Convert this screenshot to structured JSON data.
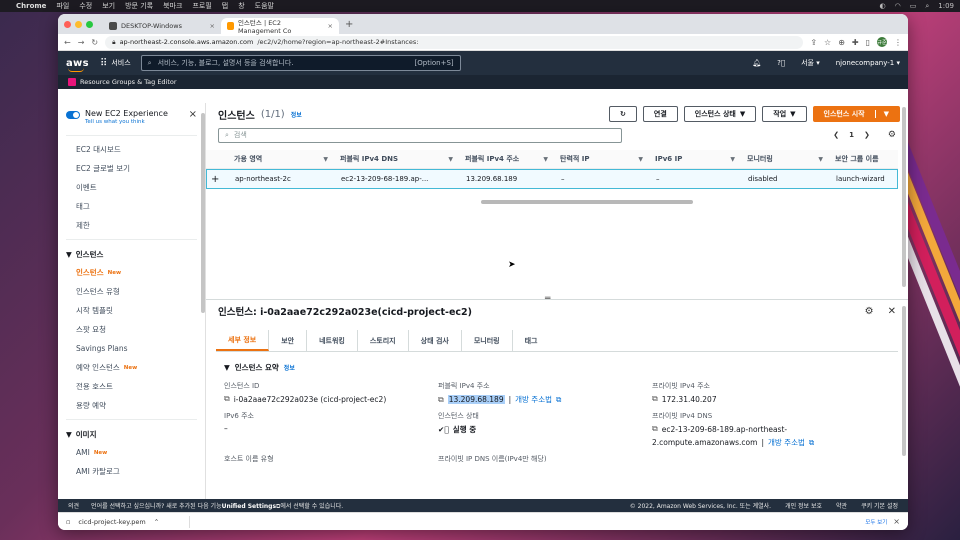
{
  "menubar": {
    "app": "Chrome",
    "items": [
      "파일",
      "수정",
      "보기",
      "방문 기록",
      "북마크",
      "프로필",
      "탭",
      "창",
      "도움말"
    ],
    "time": "1:09"
  },
  "browser": {
    "tabs": [
      {
        "title": "DESKTOP-Windows",
        "color": "#4a4a4a"
      },
      {
        "title": "인스턴스 | EC2 Management Co",
        "color": "#ff9900"
      }
    ],
    "url_host": "ap-northeast-2.console.aws.amazon.com",
    "url_path": "/ec2/v2/home?region=ap-northeast-2#Instances:",
    "profile_initials": "규준"
  },
  "aws": {
    "logo": "aws",
    "services_label": "서비스",
    "search_placeholder": "서비스, 기능, 블로그, 설명서 등을 검색합니다.",
    "search_shortcut": "[Option+S]",
    "region": "서울",
    "account": "njonecompany-1",
    "resource_groups": "Resource Groups & Tag Editor"
  },
  "sidebar": {
    "new_experience_title": "New EC2 Experience",
    "new_experience_link": "Tell us what you think",
    "top_items": [
      "EC2 대시보드",
      "EC2 글로벌 보기",
      "이벤트",
      "태그",
      "제한"
    ],
    "section_instances": "인스턴스",
    "instances_items": [
      {
        "label": "인스턴스",
        "new": "New",
        "active": true
      },
      {
        "label": "인스턴스 유형"
      },
      {
        "label": "시작 템플릿"
      },
      {
        "label": "스팟 요청"
      },
      {
        "label": "Savings Plans"
      },
      {
        "label": "예약 인스턴스",
        "new": "New"
      },
      {
        "label": "전용 호스트"
      },
      {
        "label": "용량 예약"
      }
    ],
    "section_images": "이미지",
    "images_items": [
      {
        "label": "AMI",
        "new": "New"
      },
      {
        "label": "AMI 카탈로그"
      }
    ]
  },
  "instances": {
    "title": "인스턴스",
    "count": "(1/1)",
    "info": "정보",
    "btn_connect": "연결",
    "btn_state": "인스턴스 상태",
    "btn_actions": "작업",
    "btn_launch": "인스턴스 시작",
    "filter_placeholder": "검색",
    "page": "1",
    "columns": [
      "가용 영역",
      "퍼블릭 IPv4 DNS",
      "퍼블릭 IPv4 주소",
      "탄력적 IP",
      "IPv6 IP",
      "모니터링",
      "보안 그룹 이름"
    ],
    "row": [
      "ap-northeast-2c",
      "ec2-13-209-68-189.ap-...",
      "13.209.68.189",
      "–",
      "–",
      "disabled",
      "launch-wizard"
    ]
  },
  "details": {
    "header": "인스턴스: i-0a2aae72c292a023e(cicd-project-ec2)",
    "tabs": [
      "세부 정보",
      "보안",
      "네트워킹",
      "스토리지",
      "상태 검사",
      "모니터링",
      "태그"
    ],
    "summary_title": "인스턴스 요약",
    "summary_info": "정보",
    "instance_id_label": "인스턴스 ID",
    "instance_id_value": "i-0a2aae72c292a023e (cicd-project-ec2)",
    "public_ip_label": "퍼블릭 IPv4 주소",
    "public_ip_value": "13.209.68.189",
    "open_address": "개방 주소법",
    "private_ip_label": "프라이빗 IPv4 주소",
    "private_ip_value": "172.31.40.207",
    "ipv6_label": "IPv6 주소",
    "ipv6_value": "–",
    "state_label": "인스턴스 상태",
    "state_value": "실행 중",
    "private_dns_label": "프라이빗 IPv4 DNS",
    "private_dns_value1": "ec2-13-209-68-189.ap-northeast-",
    "private_dns_value2": "2.compute.amazonaws.com",
    "hostname_type_label": "호스트 이름 유형",
    "private_ip_dns_label": "프라이빗 IP DNS 이름(IPv4만 해당)"
  },
  "footer": {
    "feedback": "의견",
    "lang_text_pre": "언어를 선택하고 싶으십니까? 새로 추가된 다음 기능",
    "unified": "Unified Settings",
    "lang_text_post": "에서 선택할 수 있습니다.",
    "copyright": "© 2022, Amazon Web Services, Inc. 또는 계열사.",
    "privacy": "개인 정보 보호",
    "terms": "약관",
    "cookies": "쿠키 기본 설정"
  },
  "downloads": {
    "file": "cicd-project-key.pem",
    "show_all": "모두 보기"
  }
}
